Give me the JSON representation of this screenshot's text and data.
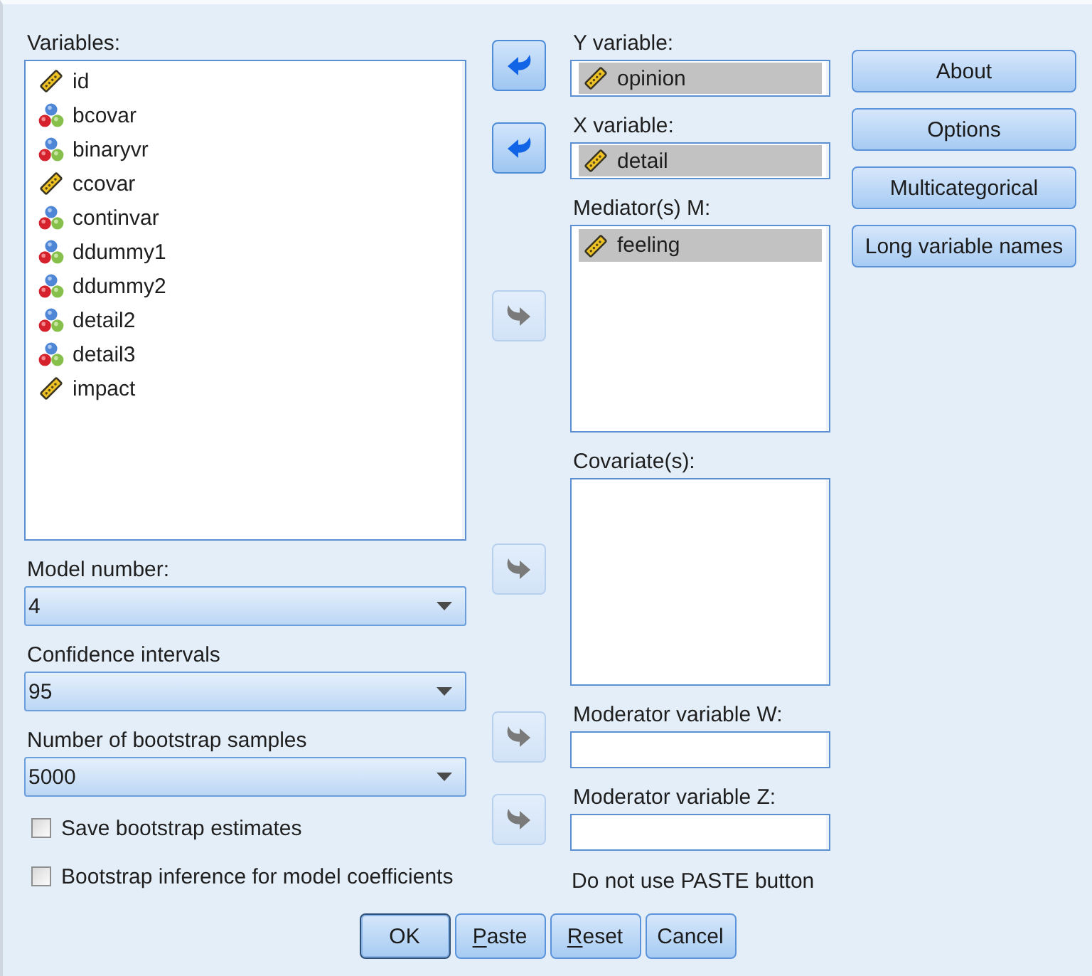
{
  "variables": {
    "label": "Variables:",
    "items": [
      {
        "name": "id",
        "kind": "scale",
        "selected": false
      },
      {
        "name": "bcovar",
        "kind": "nominal",
        "selected": false
      },
      {
        "name": "binaryvr",
        "kind": "nominal",
        "selected": false
      },
      {
        "name": "ccovar",
        "kind": "scale",
        "selected": false
      },
      {
        "name": "continvar",
        "kind": "nominal",
        "selected": false
      },
      {
        "name": "ddummy1",
        "kind": "nominal",
        "selected": false
      },
      {
        "name": "ddummy2",
        "kind": "nominal",
        "selected": false
      },
      {
        "name": "detail2",
        "kind": "nominal",
        "selected": false
      },
      {
        "name": "detail3",
        "kind": "nominal",
        "selected": false
      },
      {
        "name": "impact",
        "kind": "scale",
        "selected": false
      }
    ]
  },
  "dropdowns": [
    {
      "label": "Model number:",
      "value": "4"
    },
    {
      "label": "Confidence intervals",
      "value": "95"
    },
    {
      "label": "Number of bootstrap samples",
      "value": "5000"
    }
  ],
  "checkboxes": [
    {
      "label": "Save bootstrap estimates",
      "checked": false
    },
    {
      "label": "Bootstrap inference for model coefficients",
      "checked": false
    }
  ],
  "targets": [
    {
      "kind": "field",
      "label": "Y variable:",
      "arrow": {
        "kind": "left",
        "disabled": false
      },
      "items": [
        {
          "name": "opinion",
          "kind": "scale",
          "selected": true
        }
      ]
    },
    {
      "kind": "field",
      "label": "X variable:",
      "arrow": {
        "kind": "left",
        "disabled": false
      },
      "items": [
        {
          "name": "detail",
          "kind": "scale",
          "selected": true
        }
      ]
    },
    {
      "kind": "list",
      "label": "Mediator(s) M:",
      "arrow": {
        "kind": "right",
        "disabled": true
      },
      "items": [
        {
          "name": "feeling",
          "kind": "scale",
          "selected": true
        }
      ]
    },
    {
      "kind": "list",
      "label": "Covariate(s):",
      "arrow": {
        "kind": "right",
        "disabled": true
      }
    },
    {
      "kind": "field",
      "label": "Moderator variable W:",
      "arrow": {
        "kind": "right",
        "disabled": true
      }
    },
    {
      "kind": "field",
      "label": "Moderator variable Z:",
      "arrow": {
        "kind": "right",
        "disabled": true
      }
    }
  ],
  "note": "Do not use PASTE button",
  "side_buttons": [
    "About",
    "Options",
    "Multicategorical",
    "Long variable names"
  ],
  "footer_buttons": [
    {
      "label": "OK",
      "default": true,
      "underline_first": false
    },
    {
      "label": "Paste",
      "default": false,
      "underline_first": true
    },
    {
      "label": "Reset",
      "default": false,
      "underline_first": true
    },
    {
      "label": "Cancel",
      "default": false,
      "underline_first": false
    }
  ]
}
